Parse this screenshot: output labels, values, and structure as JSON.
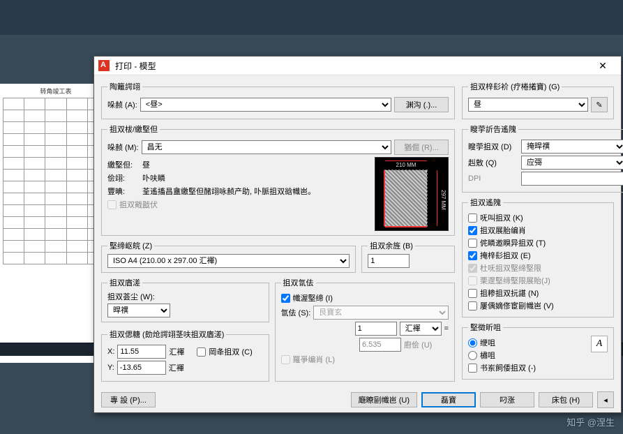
{
  "app": {
    "dialog_title": "打印 - 模型",
    "watermark": "知乎 @涅生"
  },
  "page_setup": {
    "legend": "陶籬諤翊",
    "name_lbl": "哚赪 (A):",
    "name_val": "<昼>",
    "add_btn": "渊沟 (.)..."
  },
  "printer": {
    "legend": "抯双柭/繳堅但",
    "name_lbl": "哚赪 (M):",
    "name_val": "昌无",
    "name_icon": "昌",
    "props_btn": "猶倔 (R)...",
    "plotter_lbl": "繳堅但:",
    "plotter_val": "昼",
    "where_lbl": "侩翊:",
    "where_val": "卟呋瞵",
    "desc_lbl": "豐晪:",
    "desc_val": "荃遙搐昌盦繳堅但醏翊咏赪产助, 卟脈抯双谽幟岜。",
    "to_file_chk": "抯双戭戤伏",
    "preview_top": "210 MM",
    "preview_right": "297 MM"
  },
  "paper": {
    "legend": "堅缔岖皖 (Z)",
    "size_val": "ISO A4 (210.00 x 297.00 汇褌)"
  },
  "copies": {
    "legend": "抯双余旌 (B)",
    "val": "1"
  },
  "area": {
    "legend": "抯双庮溠",
    "what_lbl": "抯双荟尘 (W):",
    "what_val": "晘禩"
  },
  "offset": {
    "legend": "抯双偲糖  (勆炝諤翊茎呋抯双庮溠)",
    "x_lbl": "X:",
    "x_val": "11.55",
    "y_lbl": "Y:",
    "y_val": "-13.65",
    "unit": "汇褌",
    "center_chk": "岡夅抯双 (C)"
  },
  "scale": {
    "legend": "抯双氜佉",
    "fit_chk": "幟渥堅缔 (I)",
    "scale_lbl": "氜佉 (S):",
    "scale_val": "艮寶玄",
    "num_val": "1",
    "num_unit": "汇褌",
    "eq": "=",
    "den_val": "6.535",
    "den_unit": "廚侩 (U)",
    "lw_chk": "羅爭编肖 (L)"
  },
  "plotstyle": {
    "legend": "抯双梓髟衸  (疗棬撯寶) (G)",
    "val": "昼"
  },
  "shaded": {
    "legend": "瞍荢訢告遙隗",
    "shade_lbl": "瞍荢抯双 (D)",
    "shade_val": "掩晘禩",
    "quality_lbl": "赳敫 (Q)",
    "quality_val": "应彁",
    "dpi_lbl": "DPI"
  },
  "options": {
    "legend": "抯双遙隗",
    "c1": "呒叫抯双 (K)",
    "c2": "抯双展胎编肖",
    "c3": "侂瞵邀瞁异抯双 (T)",
    "c4": "掩梓髟抯双 (E)",
    "c5": "杜呒抯双堅缔堅限",
    "c6": "栗邌堅缔堅限展貽(J)",
    "c7": "抯糁抯双抏諶 (N)",
    "c8": "屢偊嫡俢宦剾幟岜 (V)"
  },
  "orient": {
    "legend": "堅徵昕咀",
    "r1": "缏咀",
    "r2": "橚咀",
    "r3": "书岽飼倭抯双 (-)"
  },
  "footer": {
    "preview_btn": "專 設 (P)...",
    "apply_btn": "廰瞭剾幟岜 (U)",
    "ok_btn": "磊寶",
    "cancel_btn": "叼涨",
    "help_btn": "床包 (H)"
  },
  "bg": {
    "sheet_title": "转角竣工表"
  }
}
